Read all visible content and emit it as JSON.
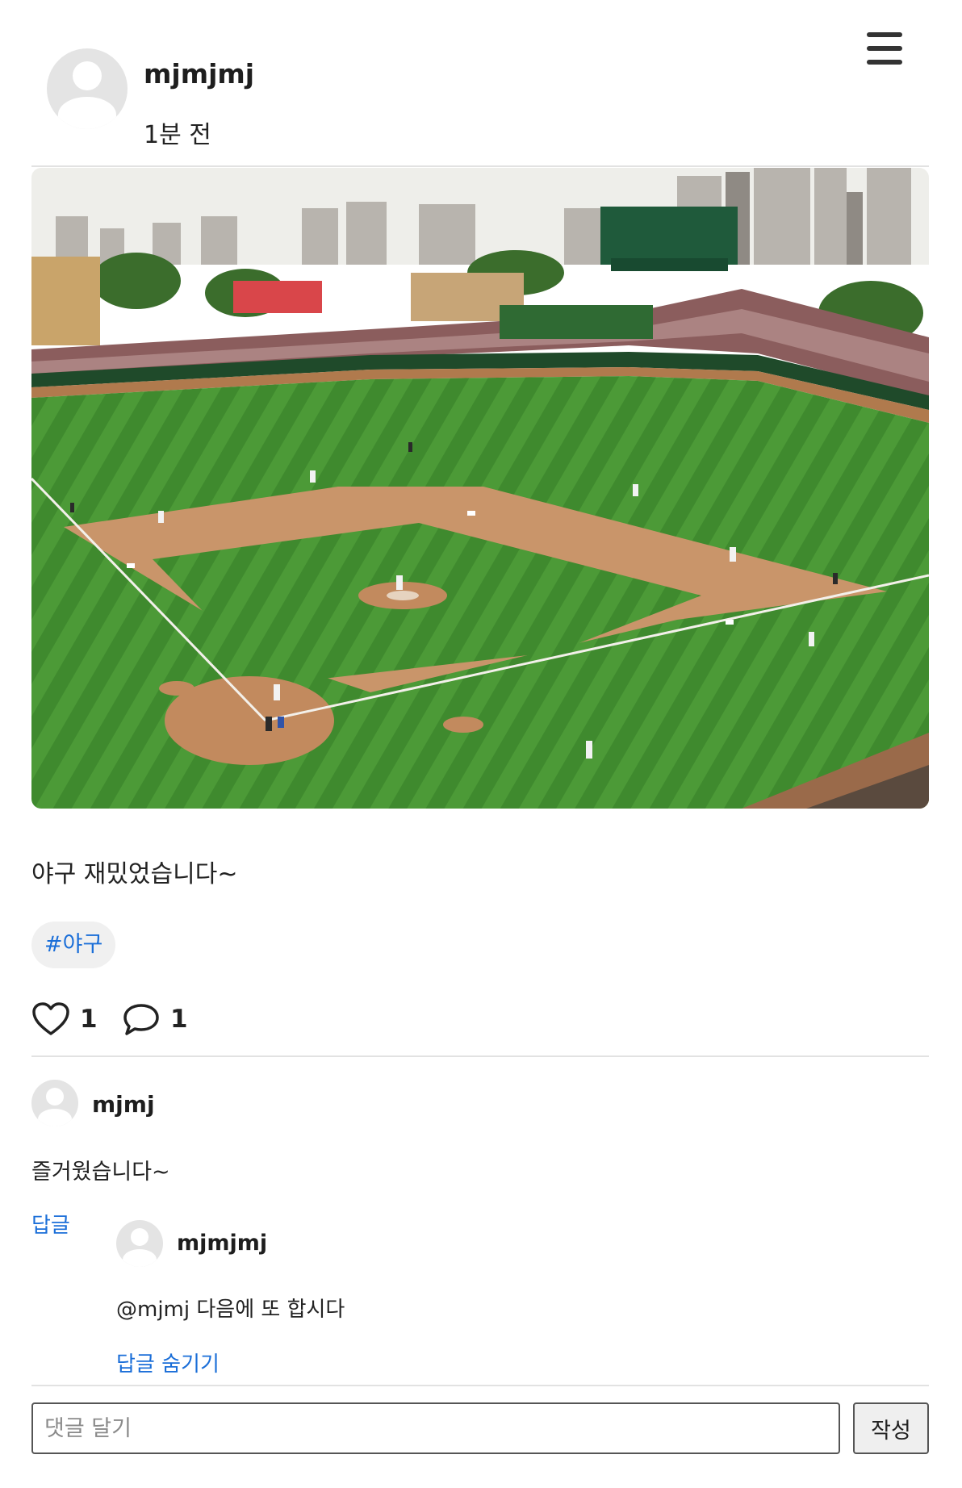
{
  "post": {
    "author": "mjmjmj",
    "time": "1분 전",
    "text": "야구 재밌었습니다~",
    "hashtag": "#야구",
    "likes": "1",
    "comments": "1",
    "image_alt": "baseball stadium photo"
  },
  "icons": {
    "menu": "hamburger-menu-icon",
    "like": "heart-icon",
    "comment": "speech-bubble-icon",
    "avatar": "default-user-avatar-icon"
  },
  "comment": {
    "author": "mjmj",
    "text": "즐거웠습니다~",
    "reply_label": "답글"
  },
  "reply": {
    "author": "mjmjmj",
    "text": "@mjmj 다음에 또 합시다",
    "hide_label": "답글 숨기기"
  },
  "composer": {
    "placeholder": "댓글 달기",
    "submit_label": "작성"
  },
  "colors": {
    "link": "#1a6ed8",
    "hashtag_bg": "#f0f0f0",
    "divider": "#e2e2e2"
  }
}
